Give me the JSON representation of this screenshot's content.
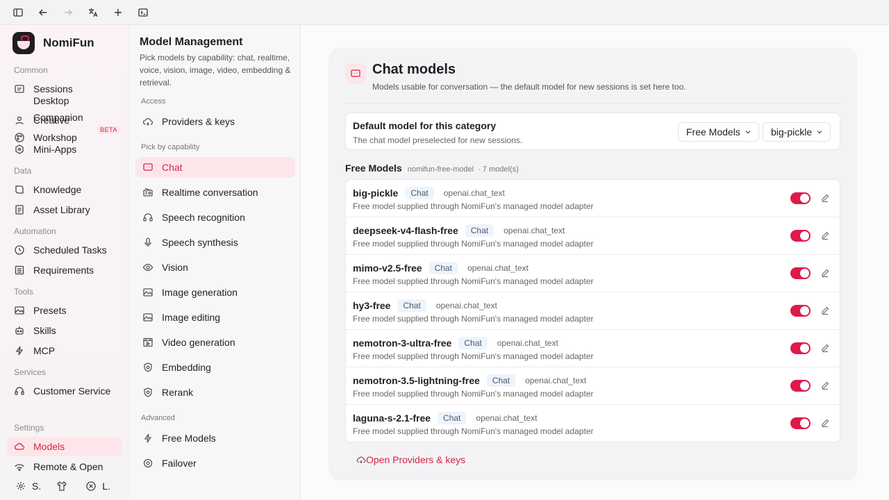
{
  "app": {
    "name": "NomiFun"
  },
  "sidebar": {
    "sections": {
      "common": "Common",
      "data": "Data",
      "automation": "Automation",
      "tools": "Tools",
      "services": "Services",
      "settings": "Settings"
    },
    "items": {
      "sessions": "Sessions",
      "desktop": "Desktop",
      "creative": "Creative",
      "companion": "Companion",
      "workshop": "Workshop",
      "beta": "BETA",
      "miniapps": "Mini-Apps",
      "knowledge": "Knowledge",
      "asset_library": "Asset Library",
      "scheduled_tasks": "Scheduled Tasks",
      "requirements": "Requirements",
      "presets": "Presets",
      "skills": "Skills",
      "mcp": "MCP",
      "customer_service": "Customer Service",
      "models": "Models",
      "remote_open": "Remote & Open",
      "footer_s": "S.",
      "footer_l": "L."
    }
  },
  "middle": {
    "title": "Model Management",
    "description": "Pick models by capability: chat, realtime, voice, vision, image, video, embedding & retrieval.",
    "sections": {
      "access": "Access",
      "capability": "Pick by capability",
      "advanced": "Advanced"
    },
    "items": {
      "providers": "Providers & keys",
      "chat": "Chat",
      "realtime": "Realtime conversation",
      "speech_recognition": "Speech recognition",
      "speech_synthesis": "Speech synthesis",
      "vision": "Vision",
      "image_generation": "Image generation",
      "image_editing": "Image editing",
      "video_generation": "Video generation",
      "embedding": "Embedding",
      "rerank": "Rerank",
      "free_models": "Free Models",
      "failover": "Failover"
    }
  },
  "main": {
    "title": "Chat models",
    "subtitle": "Models usable for conversation — the default model for new sessions is set here too.",
    "default": {
      "title": "Default model for this category",
      "subtitle": "The chat model preselected for new sessions.",
      "provider_select": "Free Models",
      "model_select": "big-pickle"
    },
    "group": {
      "title": "Free Models",
      "id": "nomifun-free-model",
      "count": "· 7 model(s)"
    },
    "models": [
      {
        "name": "big-pickle",
        "tag": "Chat",
        "protocol": "openai.chat_text",
        "desc": "Free model supplied through NomiFun's managed model adapter",
        "enabled": true
      },
      {
        "name": "deepseek-v4-flash-free",
        "tag": "Chat",
        "protocol": "openai.chat_text",
        "desc": "Free model supplied through NomiFun's managed model adapter",
        "enabled": true
      },
      {
        "name": "mimo-v2.5-free",
        "tag": "Chat",
        "protocol": "openai.chat_text",
        "desc": "Free model supplied through NomiFun's managed model adapter",
        "enabled": true
      },
      {
        "name": "hy3-free",
        "tag": "Chat",
        "protocol": "openai.chat_text",
        "desc": "Free model supplied through NomiFun's managed model adapter",
        "enabled": true
      },
      {
        "name": "nemotron-3-ultra-free",
        "tag": "Chat",
        "protocol": "openai.chat_text",
        "desc": "Free model supplied through NomiFun's managed model adapter",
        "enabled": true
      },
      {
        "name": "nemotron-3.5-lightning-free",
        "tag": "Chat",
        "protocol": "openai.chat_text",
        "desc": "Free model supplied through NomiFun's managed model adapter",
        "enabled": true
      },
      {
        "name": "laguna-s-2.1-free",
        "tag": "Chat",
        "protocol": "openai.chat_text",
        "desc": "Free model supplied through NomiFun's managed model adapter",
        "enabled": true
      }
    ],
    "open_link": "Open Providers & keys"
  },
  "colors": {
    "accent": "#e1184a",
    "accent_bg": "#fde6ea"
  }
}
